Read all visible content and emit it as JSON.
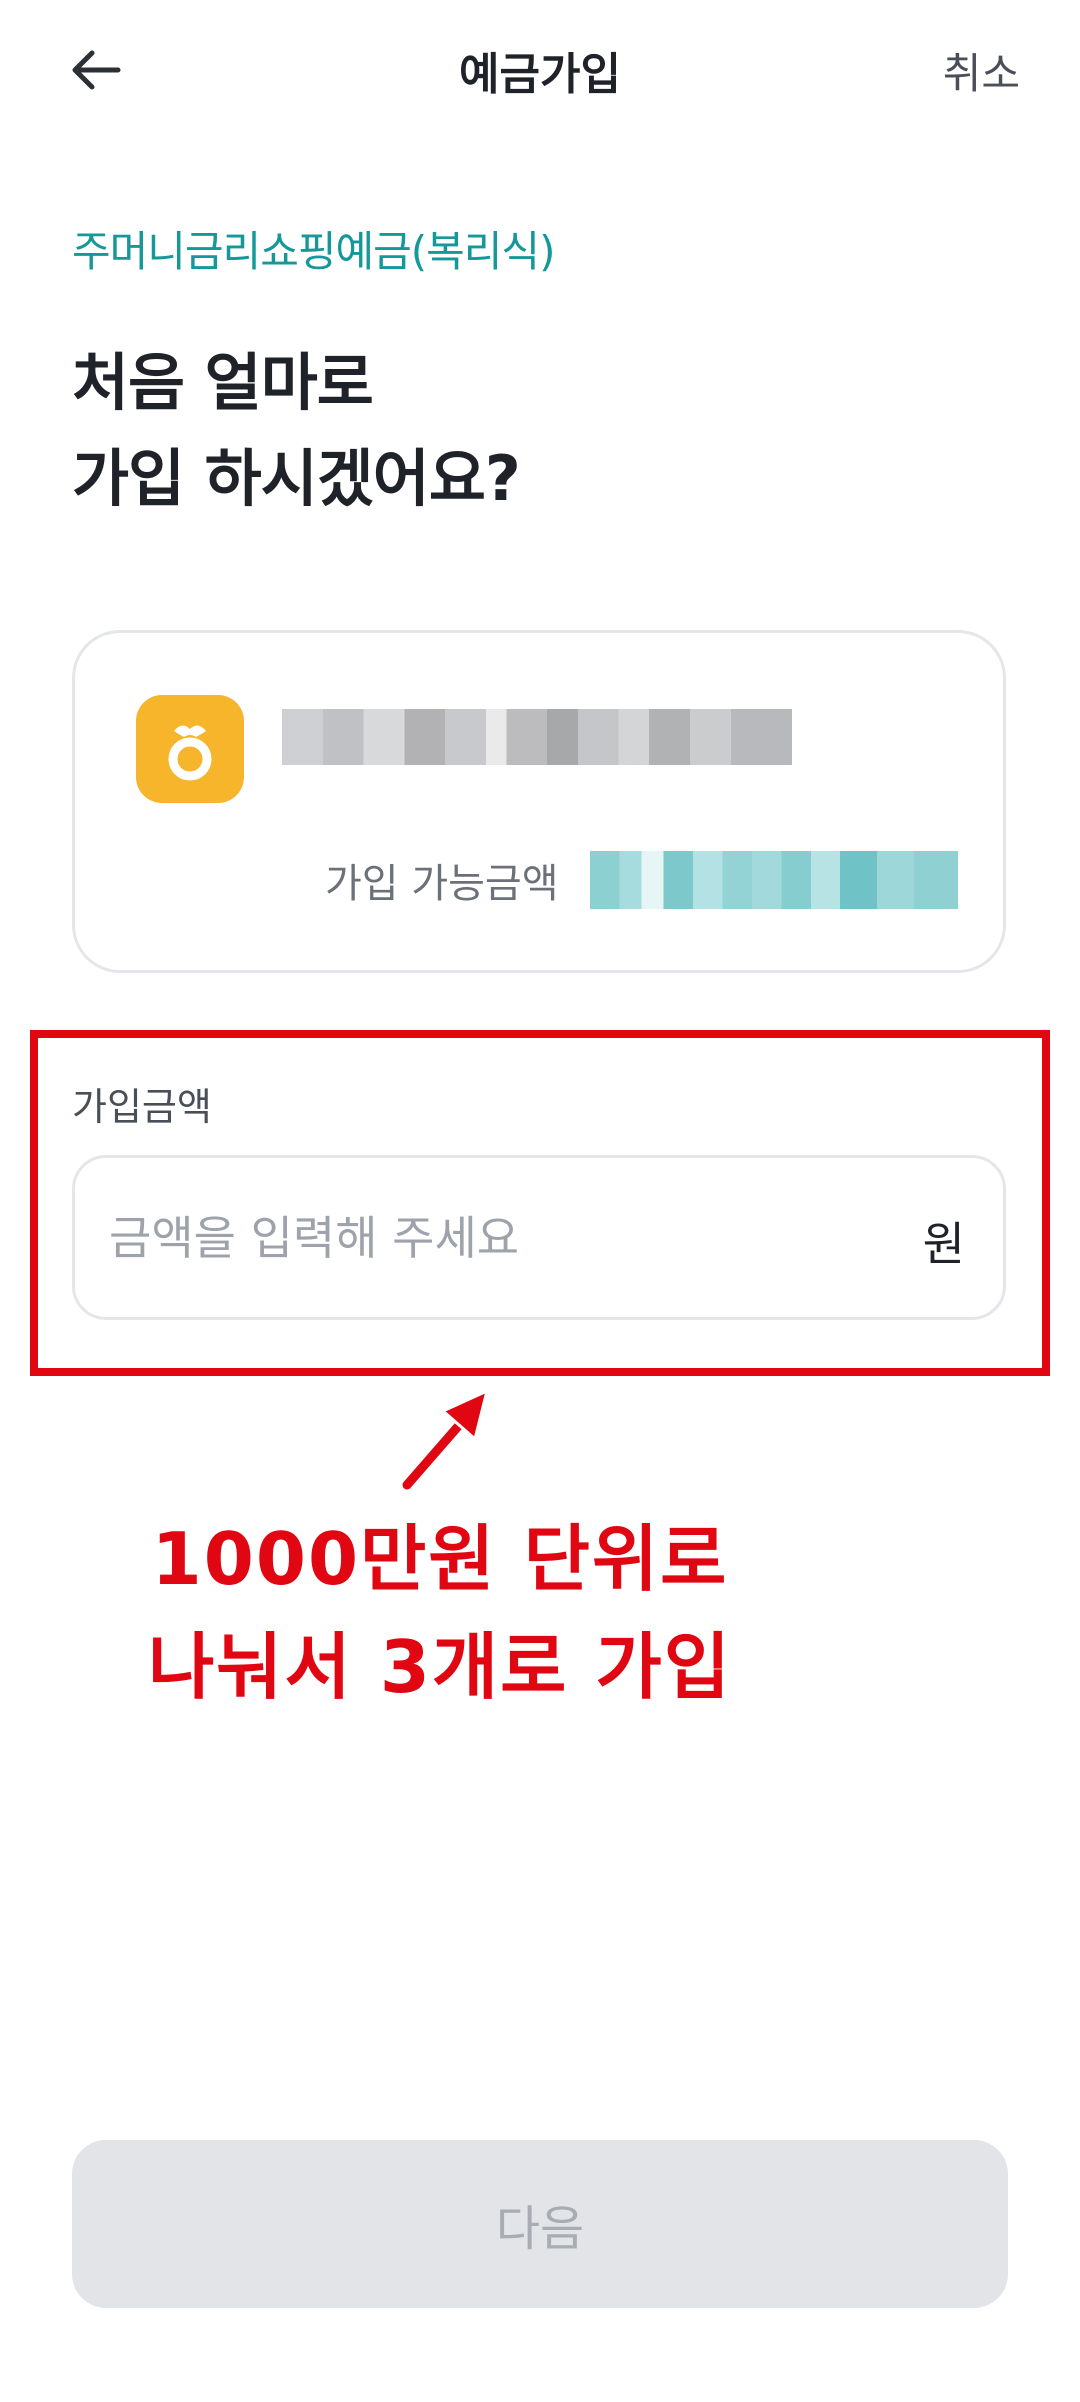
{
  "header": {
    "title": "예금가입",
    "cancel_label": "취소"
  },
  "product": {
    "name": "주머니금리쇼핑예금(복리식)"
  },
  "question": {
    "line1": "처음 얼마로",
    "line2": "가입 하시겠어요?"
  },
  "account_card": {
    "available_label": "가입 가능금액"
  },
  "amount": {
    "label": "가입금액",
    "placeholder": "금액을 입력해 주세요",
    "unit": "원"
  },
  "annotation": {
    "line1": "1000만원 단위로",
    "line2": "나눠서 3개로 가입",
    "color": "#e00612"
  },
  "footer": {
    "next_label": "다음"
  },
  "colors": {
    "accent": "#14989a",
    "bank_logo": "#f6b52a",
    "annotation_red": "#e00612"
  }
}
